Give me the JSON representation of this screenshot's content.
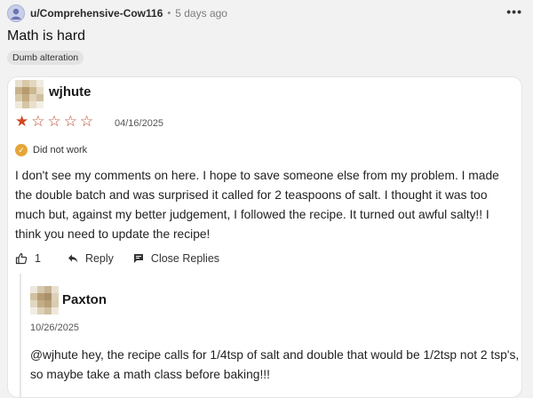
{
  "post": {
    "username": "u/Comprehensive-Cow116",
    "separator": "•",
    "time": "5 days ago",
    "more_label": "•••",
    "title": "Math is hard",
    "flair": "Dumb alteration"
  },
  "review": {
    "author": "wjhute",
    "rating": 1,
    "rating_max": 5,
    "date": "04/16/2025",
    "badge": "Did not work",
    "body": "I don't see my comments on here. I hope to save someone else from my problem. I made the double batch and was surprised it called for 2 teaspoons of salt. I thought it was too much but, against my better judgement, I followed the recipe. It turned out awful salty!! I think you need to update the recipe!",
    "likes": "1",
    "reply_label": "Reply",
    "close_replies_label": "Close Replies",
    "colors": {
      "star": "#d14624",
      "badge": "#e5a53a"
    }
  },
  "reply": {
    "author": "Paxton",
    "date": "10/26/2025",
    "body": "@wjhute hey, the recipe calls for 1/4tsp of salt and double that would be 1/2tsp not 2 tsp's, so maybe take a math class before baking!!!"
  }
}
